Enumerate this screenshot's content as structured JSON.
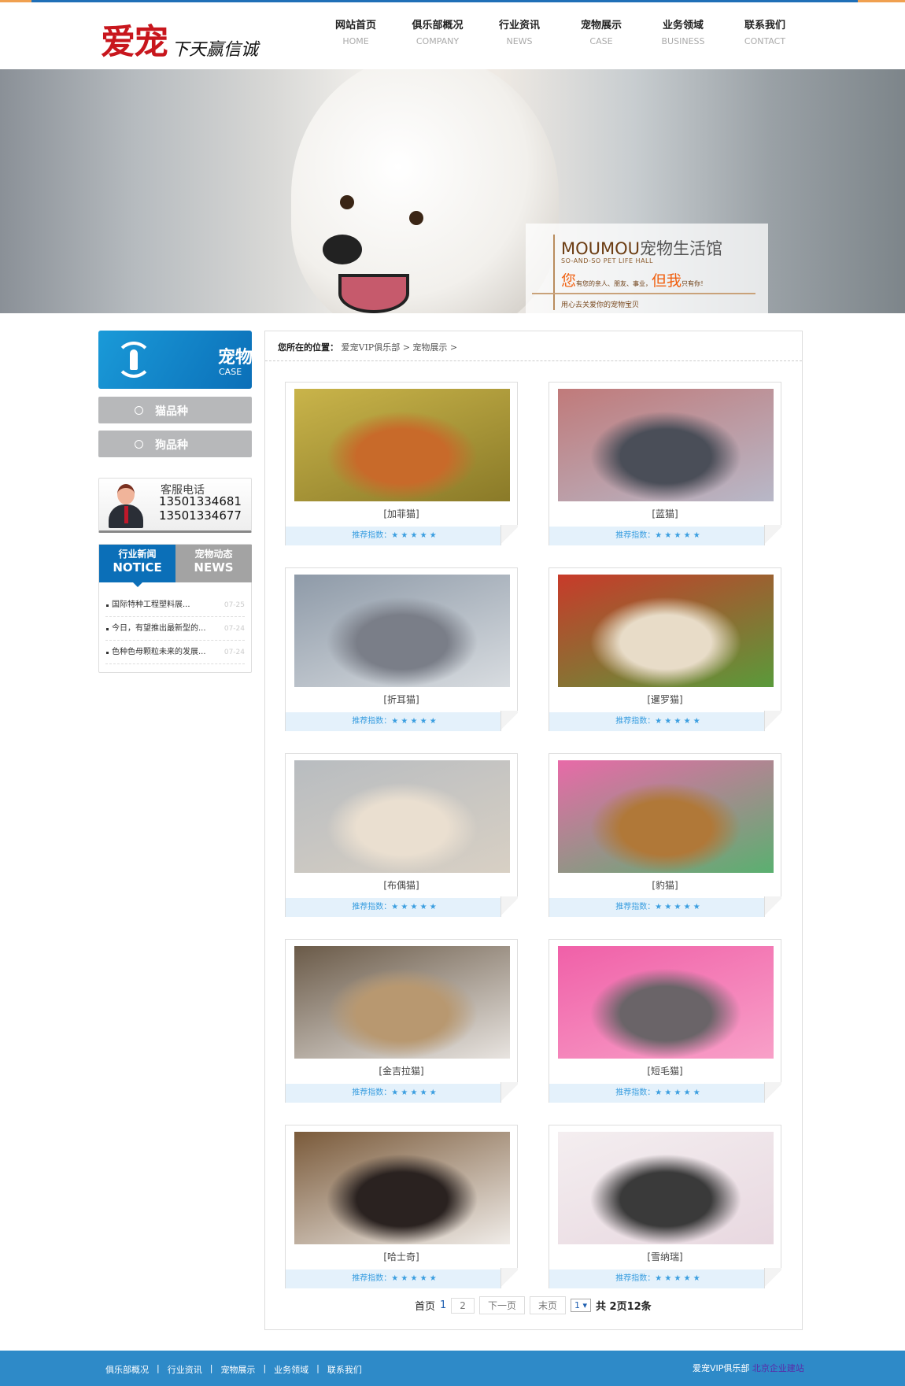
{
  "logo": {
    "brand": "爱宠",
    "slogan": "下天赢信诚"
  },
  "nav": [
    {
      "cn": "网站首页",
      "en": "HOME"
    },
    {
      "cn": "俱乐部概况",
      "en": "COMPANY"
    },
    {
      "cn": "行业资讯",
      "en": "NEWS"
    },
    {
      "cn": "宠物展示",
      "en": "CASE"
    },
    {
      "cn": "业务领域",
      "en": "BUSINESS"
    },
    {
      "cn": "联系我们",
      "en": "CONTACT"
    }
  ],
  "banner": {
    "title_en": "MOUMOU",
    "title_cn": "宠物生活馆",
    "subtitle": "SO-AND-SO PET LIFE HALL",
    "line_a": "您",
    "line_b": "有您的亲人、朋友、事业，",
    "line_c": "但我",
    "line_d": "只有你！",
    "tagline": "用心去关爱你的宠物宝贝",
    "active_slide": 2,
    "slides": 2
  },
  "sidebar": {
    "head_cn": "宠物",
    "head_en": "CASE",
    "categories": [
      "猫品种",
      "狗品种"
    ],
    "contact": {
      "label": "客服电话",
      "phones": [
        "13501334681",
        "13501334677"
      ]
    },
    "news_tabs": [
      {
        "cn": "行业新闻",
        "en": "NOTICE"
      },
      {
        "cn": "宠物动态",
        "en": "NEWS"
      }
    ],
    "news": [
      {
        "title": "国际特种工程塑料展...",
        "date": "07-25"
      },
      {
        "title": "今日，有望推出最新型的...",
        "date": "07-24"
      },
      {
        "title": "色种色母颗粒未来的发展...",
        "date": "07-24"
      }
    ]
  },
  "breadcrumb": {
    "label": "您所在的位置：",
    "items": [
      "爱宠VIP俱乐部",
      "宠物展示"
    ],
    "sep": ">"
  },
  "rating_label": "推荐指数：",
  "stars": "★ ★ ★ ★ ★",
  "rating": 5,
  "pets": [
    {
      "name": "[加菲猫]",
      "colors": [
        "#c9b44a",
        "#8a7a28",
        "#c86a2a"
      ]
    },
    {
      "name": "[蓝猫]",
      "colors": [
        "#c07a7a",
        "#b8b8c8",
        "#4a4e58"
      ]
    },
    {
      "name": "[折耳猫]",
      "colors": [
        "#8e9aa8",
        "#d8dce0",
        "#7a7e88"
      ]
    },
    {
      "name": "[暹罗猫]",
      "colors": [
        "#c83a2a",
        "#5a9a3a",
        "#e8dcc8"
      ]
    },
    {
      "name": "[布偶猫]",
      "colors": [
        "#b8bcc0",
        "#d8d0c4",
        "#eadfd0"
      ]
    },
    {
      "name": "[豹猫]",
      "colors": [
        "#e86aa8",
        "#5ab070",
        "#b07838"
      ]
    },
    {
      "name": "[金吉拉猫]",
      "colors": [
        "#6a5a48",
        "#e8e4e0",
        "#b89870"
      ]
    },
    {
      "name": "[短毛猫]",
      "colors": [
        "#f060a8",
        "#f8a0c8",
        "#6a6468"
      ]
    },
    {
      "name": "[哈士奇]",
      "colors": [
        "#7a5a3a",
        "#f0ece8",
        "#2a2220"
      ]
    },
    {
      "name": "[雪纳瑞]",
      "colors": [
        "#f4eef0",
        "#e8d8e0",
        "#3a3a3a"
      ]
    }
  ],
  "pager": {
    "first": "首页",
    "current": "1",
    "page2": "2",
    "next": "下一页",
    "last": "末页",
    "select": "1 ▾",
    "summary": "共 2页12条"
  },
  "footer": {
    "links": [
      "俱乐部概况",
      "行业资讯",
      "宠物展示",
      "业务领域",
      "联系我们"
    ],
    "sep": "|",
    "club": "爱宠VIP俱乐部",
    "site": "北京企业建站"
  }
}
